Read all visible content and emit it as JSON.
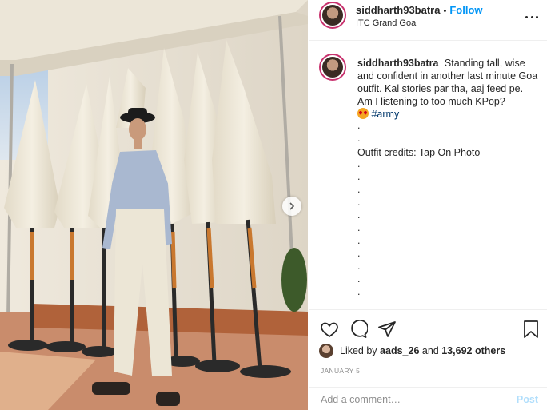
{
  "post": {
    "username": "siddharth93batra",
    "follow_label": "Follow",
    "separator": "•",
    "location": "ITC Grand Goa"
  },
  "caption": {
    "username": "siddharth93batra",
    "text": "Standing tall, wise and confident in another last minute Goa outfit. Kal stories par tha, aaj feed pe. Am I listening to too much KPop?",
    "hashtag": "#army",
    "dot": ".",
    "credits": "Outfit credits: Tap On Photo"
  },
  "likes": {
    "prefix": "Liked by",
    "user": "aads_26",
    "middle": "and",
    "others": "13,692 others"
  },
  "date": "JANUARY 5",
  "comment": {
    "placeholder": "Add a comment…",
    "post_label": "Post"
  },
  "colors": {
    "accent": "#0095f6",
    "post_disabled": "#b2dffc",
    "avatar_ring": "#c8326e"
  },
  "icons": [
    "next-arrow-icon",
    "more-icon",
    "heart-icon",
    "comment-icon",
    "share-icon",
    "bookmark-icon",
    "heart-eyes-emoji"
  ]
}
